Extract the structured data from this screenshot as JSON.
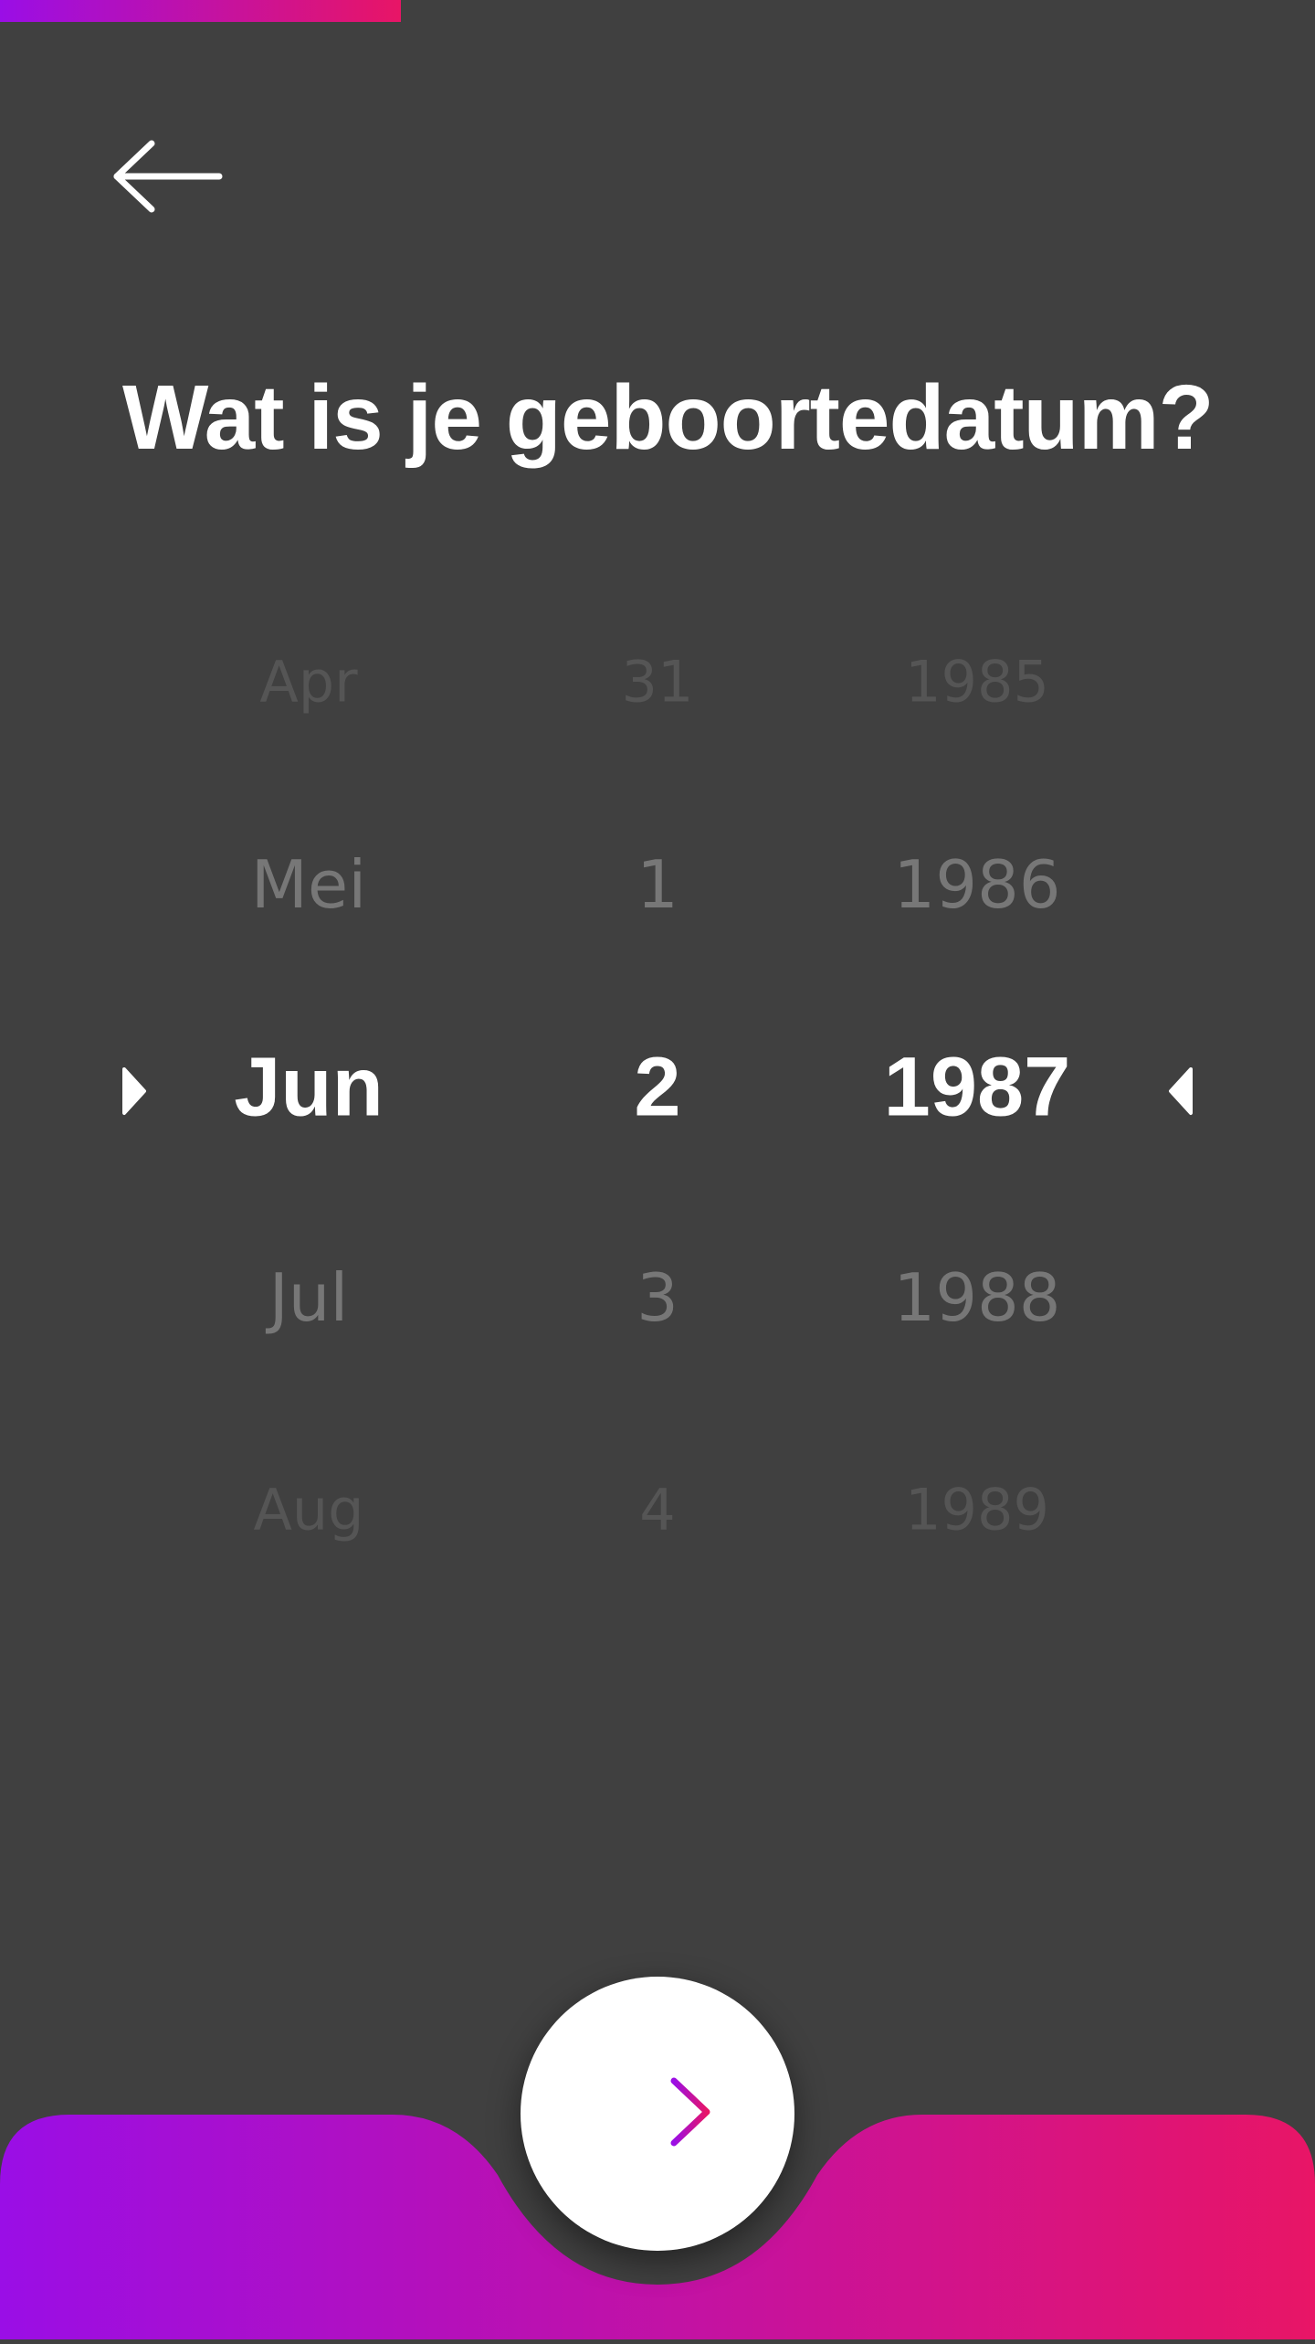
{
  "progress": {
    "fraction": 0.305,
    "colors": [
      "#9a0ee6",
      "#e81566"
    ]
  },
  "header": {
    "back_icon": "arrow-left-icon"
  },
  "page": {
    "title": "Wat is je geboortedatum?"
  },
  "picker": {
    "months": [
      "Apr",
      "Mei",
      "Jun",
      "Jul",
      "Aug"
    ],
    "days": [
      "31",
      "1",
      "2",
      "3",
      "4"
    ],
    "years": [
      "1985",
      "1986",
      "1987",
      "1988",
      "1989"
    ],
    "selected": {
      "month": "Jun",
      "day": "2",
      "year": "1987"
    },
    "marker_icons": [
      "caret-right-icon",
      "caret-left-icon"
    ]
  },
  "footer": {
    "next_icon": "arrow-right-icon",
    "gradient": [
      "#9a0ee6",
      "#e81566"
    ]
  }
}
